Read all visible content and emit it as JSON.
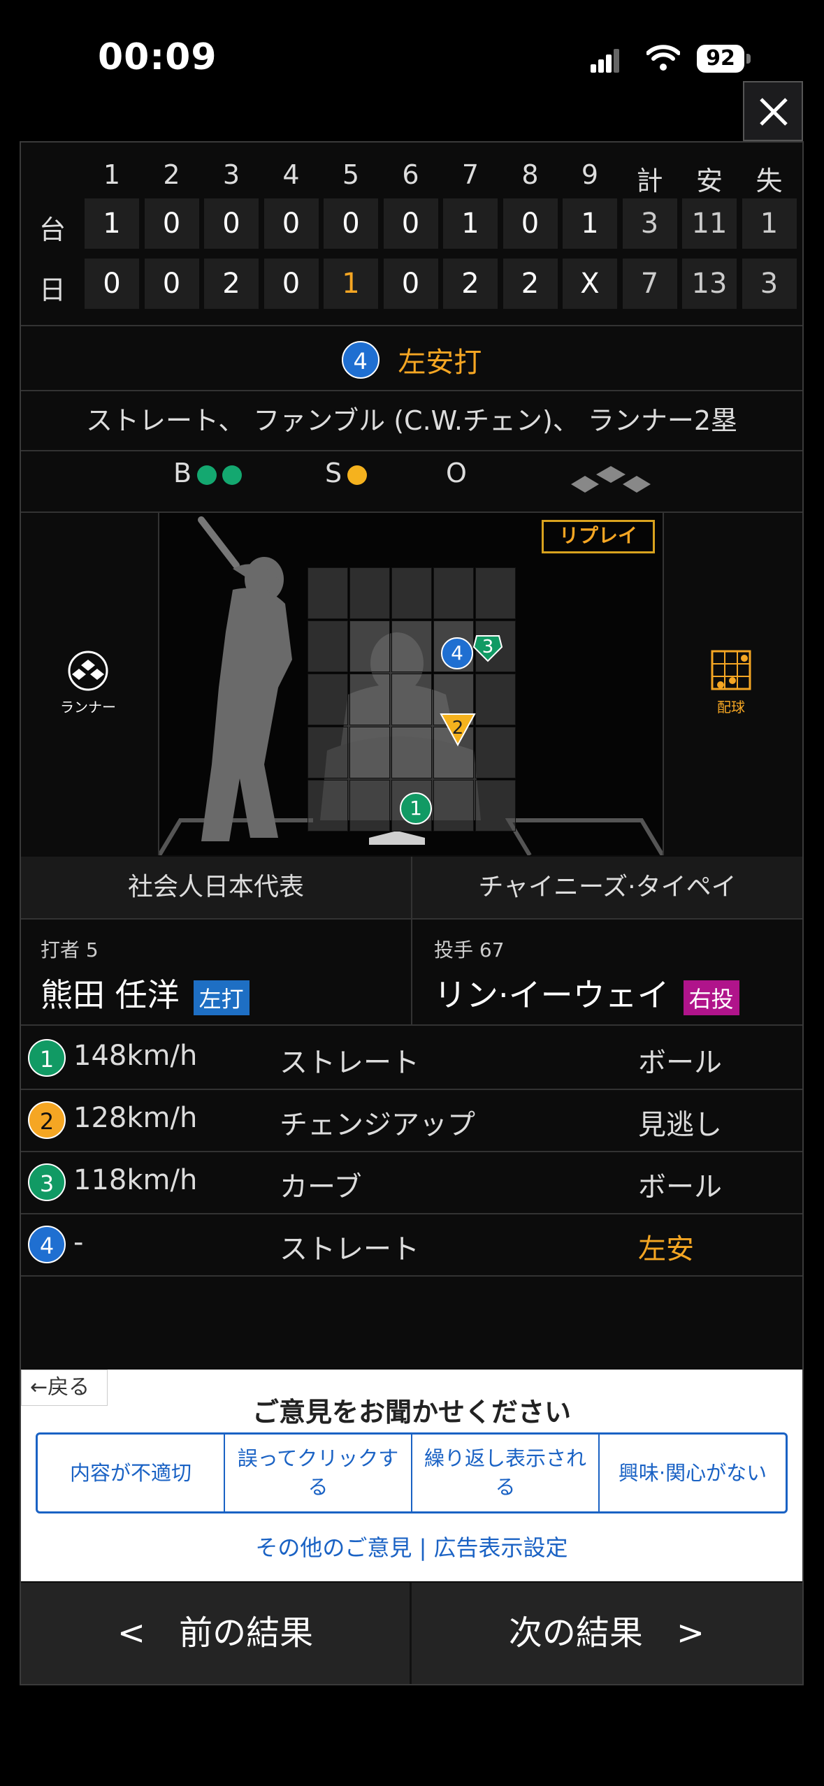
{
  "status": {
    "time": "00:09",
    "battery": "92"
  },
  "scoreboard": {
    "innings": [
      "1",
      "2",
      "3",
      "4",
      "5",
      "6",
      "7",
      "8",
      "9",
      "計",
      "安",
      "失"
    ],
    "rows": [
      {
        "team": "台",
        "values": [
          "1",
          "0",
          "0",
          "0",
          "0",
          "0",
          "1",
          "0",
          "1",
          "3",
          "11",
          "1"
        ]
      },
      {
        "team": "日",
        "values": [
          "0",
          "0",
          "2",
          "0",
          "1",
          "0",
          "2",
          "2",
          "X",
          "7",
          "13",
          "3"
        ]
      }
    ]
  },
  "play": {
    "pitch_no": "4",
    "result": "左安打",
    "description": "ストレート、 ファンブル (C.W.チェン)、 ランナー2塁"
  },
  "count": {
    "b_label": "B",
    "s_label": "S",
    "o_label": "O"
  },
  "field": {
    "replay_label": "リプレイ",
    "runner_label": "ランナー",
    "pitch_label": "配球"
  },
  "teams": {
    "home": "社会人日本代表",
    "away": "チャイニーズ·タイペイ"
  },
  "batter": {
    "role": "打者 5",
    "name": "熊田 任洋",
    "tag": "左打"
  },
  "pitcher": {
    "role": "投手 67",
    "name": "リン·イーウェイ",
    "tag": "右投"
  },
  "pitches": [
    {
      "no": "1",
      "speed": "148km/h",
      "type": "ストレート",
      "result": "ボール",
      "color": "green"
    },
    {
      "no": "2",
      "speed": "128km/h",
      "type": "チェンジアップ",
      "result": "見逃し",
      "color": "yellow"
    },
    {
      "no": "3",
      "speed": "118km/h",
      "type": "カーブ",
      "result": "ボール",
      "color": "green"
    },
    {
      "no": "4",
      "speed": "-",
      "type": "ストレート",
      "result": "左安",
      "color": "blue"
    }
  ],
  "feedback": {
    "back": "戻る",
    "title": "ご意見をお聞かせください",
    "options": [
      "内容が不適切",
      "誤ってクリックする",
      "繰り返し表示される",
      "興味·関心がない"
    ],
    "links": "その他のご意見 | 広告表示設定"
  },
  "nav": {
    "prev": "<　前の結果",
    "next": "次の結果　>"
  }
}
